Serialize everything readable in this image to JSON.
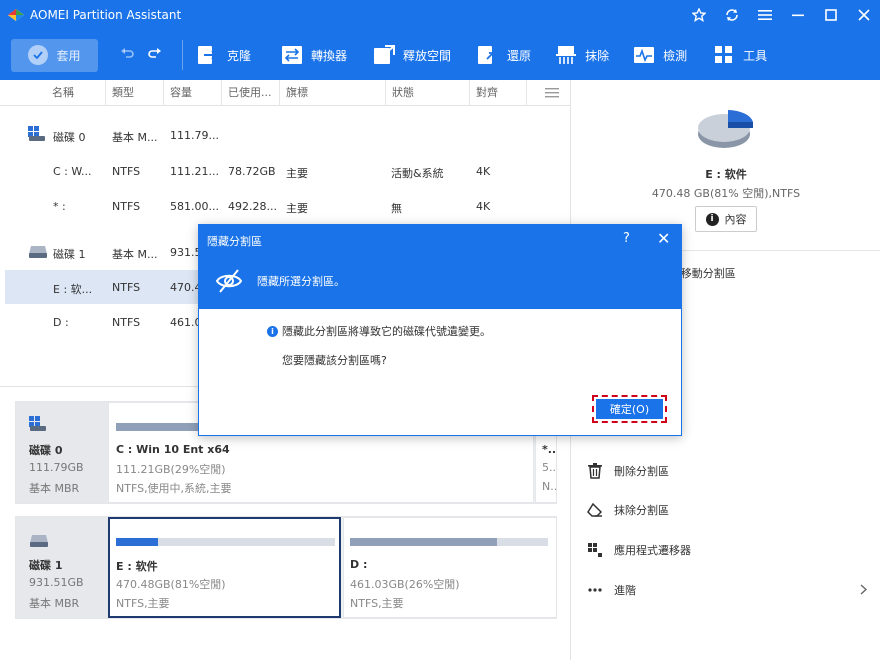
{
  "window": {
    "title": "AOMEI Partition Assistant"
  },
  "toolbar": {
    "apply_label": "套用",
    "tools": [
      {
        "label": "克隆",
        "icon": "clone-icon"
      },
      {
        "label": "轉換器",
        "icon": "converter-icon"
      },
      {
        "label": "釋放空間",
        "icon": "free-space-icon"
      },
      {
        "label": "還原",
        "icon": "restore-icon"
      },
      {
        "label": "抹除",
        "icon": "wipe-icon"
      },
      {
        "label": "檢測",
        "icon": "test-icon"
      },
      {
        "label": "工具",
        "icon": "tools-icon"
      }
    ]
  },
  "table": {
    "headers": [
      "名稱",
      "類型",
      "容量",
      "已使用...",
      "旗標",
      "狀態",
      "對齊"
    ],
    "rows": [
      {
        "name": "磁碟 0",
        "type": "基本 M...",
        "capacity": "111.79...",
        "used": "",
        "flag": "",
        "status": "",
        "align": "",
        "kind": "disk"
      },
      {
        "name": "C : W...",
        "type": "NTFS",
        "capacity": "111.21...",
        "used": "78.72GB",
        "flag": "主要",
        "status": "活動&系統",
        "align": "4K",
        "kind": "part"
      },
      {
        "name": "* :",
        "type": "NTFS",
        "capacity": "581.00...",
        "used": "492.28...",
        "flag": "主要",
        "status": "無",
        "align": "4K",
        "kind": "part"
      },
      {
        "name": "磁碟 1",
        "type": "基本 M...",
        "capacity": "931.5",
        "used": "",
        "flag": "",
        "status": "",
        "align": "",
        "kind": "disk"
      },
      {
        "name": "E : 软...",
        "type": "NTFS",
        "capacity": "470.4",
        "used": "",
        "flag": "",
        "status": "",
        "align": "",
        "kind": "part"
      },
      {
        "name": "D :",
        "type": "NTFS",
        "capacity": "461.0",
        "used": "",
        "flag": "",
        "status": "",
        "align": "",
        "kind": "part"
      }
    ]
  },
  "diskmap": {
    "disk0": {
      "name": "磁碟 0",
      "size": "111.79GB",
      "type": "基本 MBR",
      "partitions": [
        {
          "name": "C : Win 10 Ent x64",
          "size": "111.21GB(29%空閒)",
          "info": "NTFS,使用中,系統,主要",
          "used_pct": 71
        },
        {
          "name": "*...",
          "size": "5...",
          "info": "N..."
        }
      ]
    },
    "disk1": {
      "name": "磁碟 1",
      "size": "931.51GB",
      "type": "基本 MBR",
      "partitions": [
        {
          "name": "E : 软件",
          "size": "470.48GB(81%空閒)",
          "info": "NTFS,主要",
          "used_pct": 19
        },
        {
          "name": "D :",
          "size": "461.03GB(26%空閒)",
          "info": "NTFS,主要",
          "used_pct": 74
        }
      ]
    }
  },
  "right_panel": {
    "selected_name": "E : 软件",
    "selected_size": "470.48 GB(81% 空閒),NTFS",
    "properties_label": "內容",
    "ops": [
      {
        "label": "/移動分割區",
        "icon": "resize-icon"
      },
      {
        "label": "刪除分割區",
        "icon": "trash-icon"
      },
      {
        "label": "抹除分割區",
        "icon": "eraser-icon"
      },
      {
        "label": "應用程式遷移器",
        "icon": "app-mover-icon"
      },
      {
        "label": "進階",
        "icon": "more-icon"
      }
    ],
    "used_pct": 19
  },
  "dialog": {
    "title": "隱藏分割區",
    "subtitle": "隱藏所選分割區。",
    "info": "隱藏此分割區將導致它的磁碟代號遺變更。",
    "question": "您要隱藏該分割區嗎?",
    "ok_label": "確定(O)"
  },
  "colors": {
    "accent": "#1a73e8",
    "highlight": "#d0021b",
    "bar_blue": "#2b6fd6",
    "bar_gray": "#8fa0b8"
  }
}
